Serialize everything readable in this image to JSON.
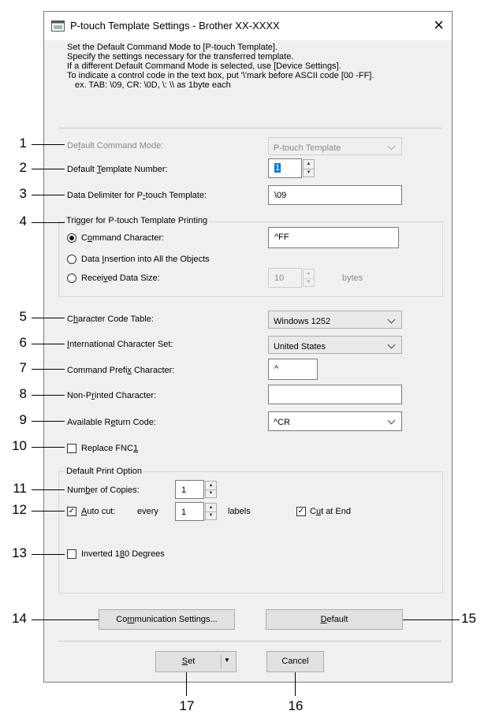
{
  "window": {
    "title": "P-touch Template Settings - Brother XX-XXXX",
    "close": "×"
  },
  "intro": {
    "line1": "Set the Default Command Mode to [P-touch Template].",
    "line2": "Specify the settings necessary for the transferred template.",
    "line3": "If a different Default Command Mode is selected, use [Device Settings].",
    "line4": "To indicate a control code in the text box, put '\\'mark before ASCII code [00 -FF].",
    "line5": "ex. TAB: \\09,  CR: \\0D,  \\: \\\\  as 1byte each"
  },
  "fields": {
    "default_command_mode": {
      "label_a": "De",
      "label_u": "f",
      "label_b": "ault Command Mode:",
      "value": "P-touch Template"
    },
    "default_template_number": {
      "label_a": "Default ",
      "label_u": "T",
      "label_b": "emplate Number:",
      "value": "1"
    },
    "data_delimiter": {
      "label_a": "Data Delimiter for P",
      "label_u": "-",
      "label_b": "touch Template:",
      "value": "\\09"
    },
    "trigger_group": "Trigger for P-touch Template Printing",
    "command_character": {
      "label_a": "C",
      "label_u": "o",
      "label_b": "mmand Character:",
      "value": "^FF"
    },
    "data_insertion": {
      "label_a": "Data ",
      "label_u": "I",
      "label_b": "nsertion into All the Objects"
    },
    "received_data_size": {
      "label_a": "Recei",
      "label_u": "v",
      "label_b": "ed Data Size:",
      "value": "10",
      "unit": "bytes"
    },
    "character_code_table": {
      "label_a": "C",
      "label_u": "h",
      "label_b": "aracter Code Table:",
      "value": "Windows 1252"
    },
    "international_charset": {
      "label_a": "",
      "label_u": "I",
      "label_b": "nternational Character Set:",
      "value": "United States"
    },
    "command_prefix": {
      "label_a": "Command Prefi",
      "label_u": "x",
      "label_b": " Character:",
      "value": "^"
    },
    "non_printed": {
      "label_a": "Non-P",
      "label_u": "r",
      "label_b": "inted Character:",
      "value": ""
    },
    "return_code": {
      "label_a": "Available R",
      "label_u": "e",
      "label_b": "turn Code:",
      "value": "^CR"
    },
    "replace_fnc1": {
      "label_a": "Replace FNC",
      "label_u": "1",
      "label_b": ""
    }
  },
  "print_option": {
    "group": "Default Print Option",
    "copies": {
      "label_a": "Num",
      "label_u": "b",
      "label_b": "er of Copies:",
      "value": "1"
    },
    "auto_cut": {
      "label_a": "",
      "label_u": "A",
      "label_b": "uto cut:",
      "every": "every",
      "value": "1",
      "unit": "labels"
    },
    "cut_at_end": {
      "label_a": "C",
      "label_u": "u",
      "label_b": "t at End"
    },
    "inverted": {
      "label_a": "Inverted 1",
      "label_u": "8",
      "label_b": "0 Degrees"
    }
  },
  "buttons": {
    "communication": {
      "a": "Co",
      "u": "m",
      "b": "munication Settings..."
    },
    "default": {
      "a": "",
      "u": "D",
      "b": "efault"
    },
    "set": {
      "a": "",
      "u": "S",
      "b": "et"
    },
    "cancel": "Cancel"
  },
  "callouts": [
    "1",
    "2",
    "3",
    "4",
    "5",
    "6",
    "7",
    "8",
    "9",
    "10",
    "11",
    "12",
    "13",
    "14",
    "15",
    "16",
    "17"
  ],
  "colors": {
    "dialog_bg": "#f0f0f0",
    "selection": "#0078d7"
  }
}
